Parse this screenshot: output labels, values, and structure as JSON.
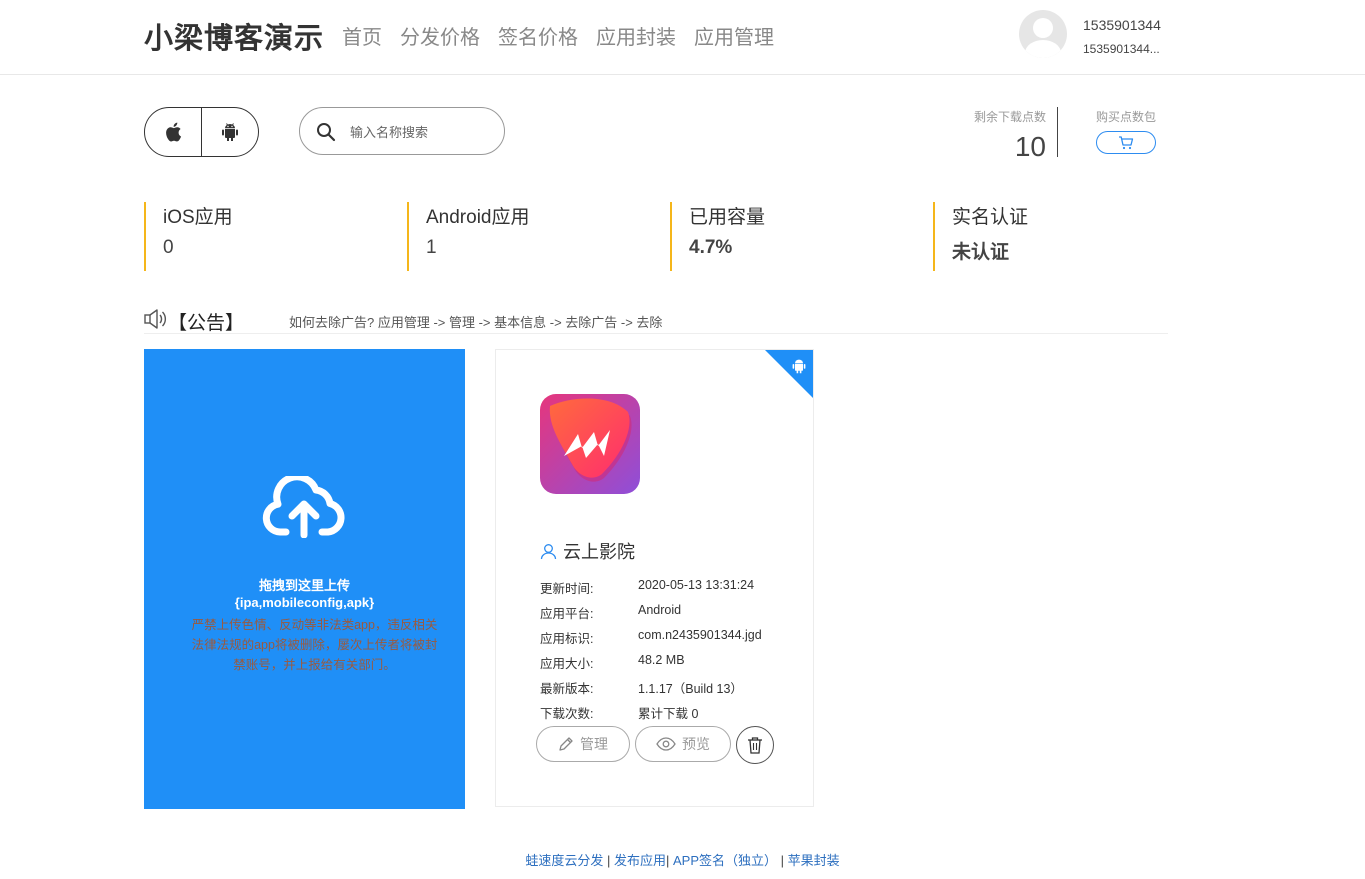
{
  "header": {
    "brand": "小梁博客演示",
    "nav": [
      "首页",
      "分发价格",
      "签名价格",
      "应用封装",
      "应用管理"
    ],
    "user_name": "1535901344",
    "user_sub": "1535901344..."
  },
  "toolbar": {
    "search_placeholder": "输入名称搜索",
    "points_label": "剩余下载点数",
    "points_value": "10",
    "buy_label": "购买点数包"
  },
  "stats": [
    {
      "title": "iOS应用",
      "value": "0"
    },
    {
      "title": "Android应用",
      "value": "1"
    },
    {
      "title": "已用容量",
      "value": "4.7%"
    },
    {
      "title": "实名认证",
      "value": "未认证"
    }
  ],
  "notice": {
    "title": "【公告】",
    "text": "如何去除广告? 应用管理 -> 管理 -> 基本信息 -> 去除广告 -> 去除"
  },
  "upload": {
    "line1": "拖拽到这里上传",
    "line2": "{ipa,mobileconfig,apk}",
    "warning": "严禁上传色情、反动等非法类app，违反相关法律法规的app将被删除，屡次上传者将被封禁账号，并上报给有关部门。"
  },
  "app": {
    "name": "云上影院",
    "details": [
      {
        "label": "更新时间:",
        "value": "2020-05-13 13:31:24"
      },
      {
        "label": "应用平台:",
        "value": "Android"
      },
      {
        "label": "应用标识:",
        "value": "com.n2435901344.jgd"
      },
      {
        "label": "应用大小:",
        "value": "48.2 MB"
      },
      {
        "label": "最新版本:",
        "value": "1.1.17（Build 13）"
      },
      {
        "label": "下载次数:",
        "value": "累计下载 0"
      }
    ],
    "manage_label": "管理",
    "preview_label": "预览"
  },
  "footer": {
    "link1": "蛙速度云分发",
    "sep1": " | ",
    "link2": "发布应用",
    "sep2": "| ",
    "link3": "APP签名（独立）",
    "sep3": " | ",
    "link4": "苹果封装"
  },
  "colors": {
    "accent": "#1f8ff7",
    "stat_border": "#f5b61a",
    "link": "#2d6fbf"
  }
}
